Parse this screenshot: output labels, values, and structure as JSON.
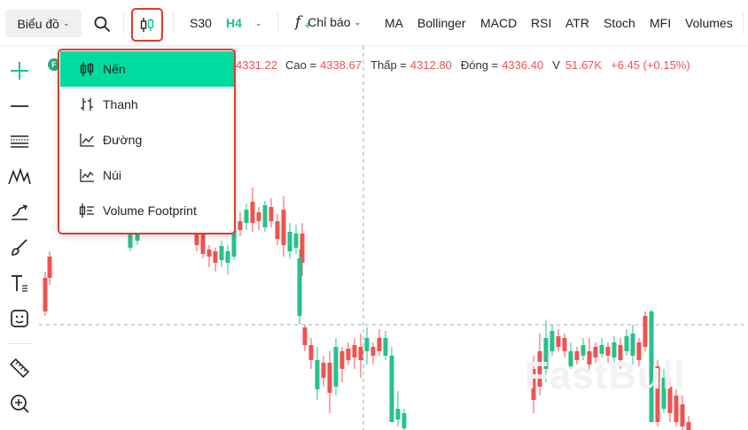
{
  "toolbar": {
    "chart_mode_label": "Biểu đồ",
    "symbol": "S30",
    "interval": "H4",
    "indicators_label": "Chỉ báo",
    "indicators": [
      "MA",
      "Bollinger",
      "MACD",
      "RSI",
      "ATR",
      "Stoch",
      "MFI",
      "Volumes"
    ],
    "colors": {
      "accent": "#19c48a",
      "highlight_border": "#e03a2e"
    }
  },
  "legend": {
    "open_value": "4331.22",
    "high_label": "Cao =",
    "high_value": "4338.67",
    "low_label": "Thấp =",
    "low_value": "4312.80",
    "close_label": "Đóng =",
    "close_value": "4336.40",
    "volume_label": "V",
    "volume_value": "51.67K",
    "change": "+6.45 (+0.15%)",
    "badge": "F"
  },
  "dropdown": {
    "items": [
      {
        "label": "Nến",
        "icon": "candlestick-icon",
        "selected": true
      },
      {
        "label": "Thanh",
        "icon": "bar-ohlc-icon",
        "selected": false
      },
      {
        "label": "Đường",
        "icon": "line-chart-icon",
        "selected": false
      },
      {
        "label": "Núi",
        "icon": "area-chart-icon",
        "selected": false
      },
      {
        "label": "Volume Footprint",
        "icon": "volume-footprint-icon",
        "selected": false
      }
    ],
    "selected_color": "#00dca0"
  },
  "left_tools": [
    "crosshair-icon",
    "horizontal-line-icon",
    "fib-lines-icon",
    "pattern-icon",
    "trend-icon",
    "brush-icon",
    "text-icon",
    "emoji-icon",
    "ruler-icon",
    "zoom-in-icon"
  ],
  "watermark": "FastBull",
  "colors": {
    "up": "#26c28b",
    "down": "#ef5350",
    "grid": "#b7b7b7"
  }
}
